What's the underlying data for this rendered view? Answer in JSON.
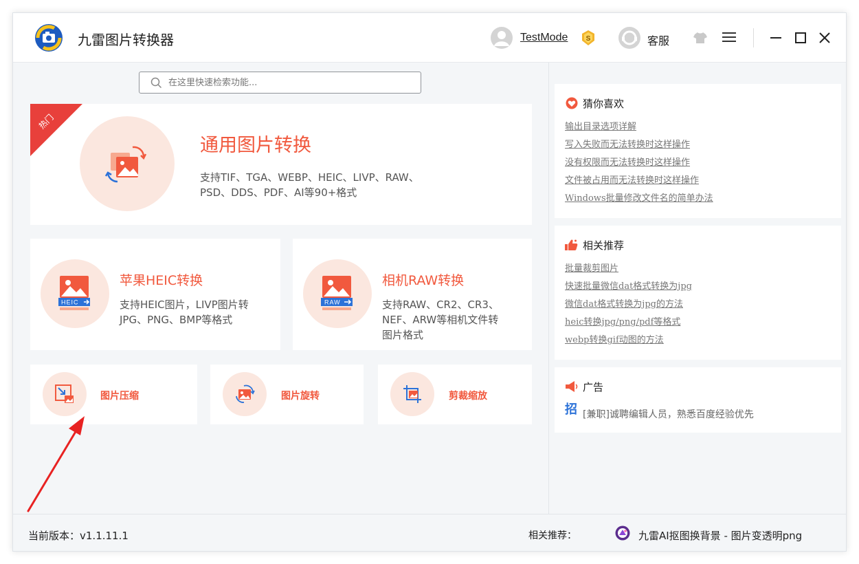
{
  "app": {
    "title": "九雷图片转换器"
  },
  "header": {
    "user_name": "TestMode",
    "vip_badge": "S",
    "service_label": "客服"
  },
  "search": {
    "placeholder": "在这里快速检索功能..."
  },
  "hero": {
    "badge": "热门",
    "title": "通用图片转换",
    "desc_line1": "支持TIF、TGA、WEBP、HEIC、LIVP、RAW、",
    "desc_line2": "PSD、DDS、PDF、AI等90+格式"
  },
  "heic": {
    "title": "苹果HEIC转换",
    "icon_tag": "HEIC",
    "desc_line1": "支持HEIC图片，LIVP图片转",
    "desc_line2": "JPG、PNG、BMP等格式"
  },
  "raw": {
    "title": "相机RAW转换",
    "icon_tag": "RAW",
    "desc_line1": "支持RAW、CR2、CR3、",
    "desc_line2": "NEF、ARW等相机文件转",
    "desc_line3": "图片格式"
  },
  "tools": {
    "compress": "图片压缩",
    "rotate": "图片旋转",
    "crop": "剪裁缩放"
  },
  "guess": {
    "title": "猜你喜欢",
    "links": [
      "输出目录选项详解",
      "写入失败而无法转换时这样操作",
      "没有权限而无法转换时这样操作",
      "文件被占用而无法转换时这样操作",
      "Windows批量修改文件名的简单办法"
    ]
  },
  "recommend": {
    "title": "相关推荐",
    "links": [
      "批量裁剪图片",
      "快速批量微信dat格式转换为jpg",
      "微信dat格式转换为jpg的方法",
      "heic转换jpg/png/pdf等格式",
      "webp转换gif动图的方法"
    ]
  },
  "ad": {
    "title": "广告",
    "icon_char": "招",
    "text": "[兼职]诚聘编辑人员，熟悉百度经验优先"
  },
  "footer": {
    "version": "当前版本：v1.1.11.1",
    "rec_label": "相关推荐：",
    "rec_link": "九雷AI抠图换背景 - 图片变透明png"
  },
  "colors": {
    "accent": "#f1593e",
    "accent_light": "#fbe7df",
    "hot_red": "#e8403b",
    "icon_blue": "#2c72d8"
  }
}
